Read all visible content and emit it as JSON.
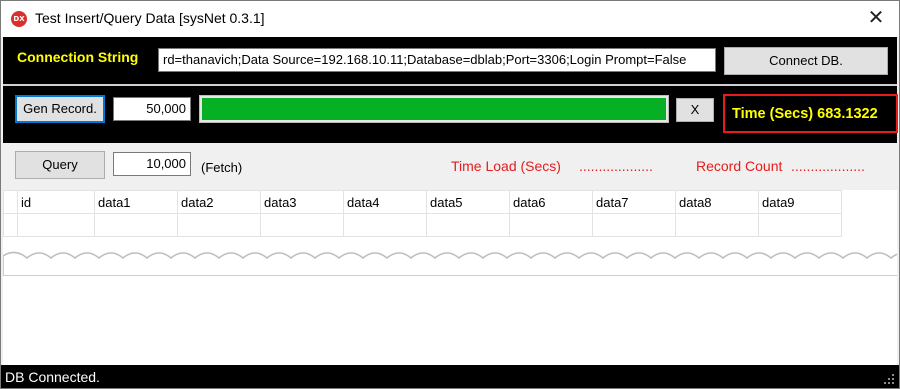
{
  "window": {
    "title": "Test Insert/Query Data [sysNet 0.3.1]",
    "app_icon_text": "DX",
    "close_glyph": "✕"
  },
  "connection": {
    "label": "Connection String",
    "value": "rd=thanavich;Data Source=192.168.10.11;Database=dblab;Port=3306;Login Prompt=False",
    "connect_button": "Connect DB."
  },
  "generate": {
    "button": "Gen Record.",
    "count": "50,000",
    "progress": 1.0,
    "cancel_button": "X",
    "time_label": "Time (Secs) 683.1322"
  },
  "query": {
    "button": "Query",
    "fetch": "10,000",
    "fetch_label": "(Fetch)",
    "time_load_label": "Time Load (Secs)",
    "time_load_value": "...................",
    "record_count_label": "Record Count",
    "record_count_value": "..................."
  },
  "grid": {
    "columns": [
      "id",
      "data1",
      "data2",
      "data3",
      "data4",
      "data5",
      "data6",
      "data7",
      "data8",
      "data9"
    ],
    "rows": [
      [
        "",
        "",
        "",
        "",
        "",
        "",
        "",
        "",
        "",
        ""
      ]
    ]
  },
  "status": {
    "text": "DB Connected."
  },
  "colors": {
    "accent_yellow": "#ffff00",
    "alert_red": "#e81c1c",
    "progress_green": "#06b025",
    "panel_black": "#000000"
  }
}
